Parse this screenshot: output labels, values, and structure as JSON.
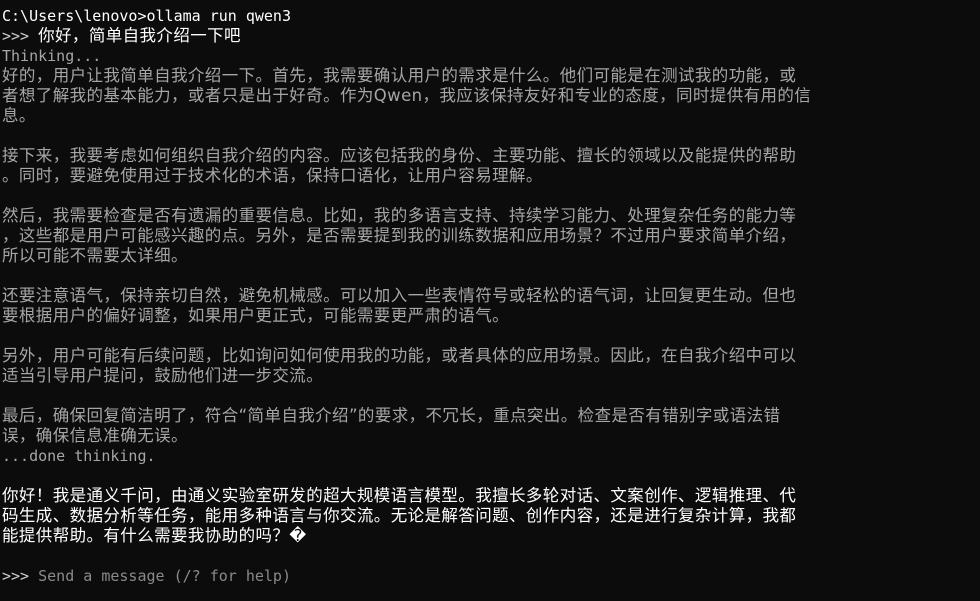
{
  "terminal": {
    "command_line": "C:\\Users\\lenovo>ollama run qwen3",
    "user_prompt": {
      "marker": ">>>",
      "text": "你好，简单自我介绍一下吧"
    },
    "thinking_header": "Thinking...",
    "thinking_paragraphs": [
      [
        "好的，用户让我简单自我介绍一下。首先，我需要确认用户的需求是什么。他们可能是在测试我的功能，或",
        "者想了解我的基本能力，或者只是出于好奇。作为Qwen，我应该保持友好和专业的态度，同时提供有用的信",
        "息。"
      ],
      [
        "接下来，我要考虑如何组织自我介绍的内容。应该包括我的身份、主要功能、擅长的领域以及能提供的帮助",
        "。同时，要避免使用过于技术化的术语，保持口语化，让用户容易理解。"
      ],
      [
        "然后，我需要检查是否有遗漏的重要信息。比如，我的多语言支持、持续学习能力、处理复杂任务的能力等",
        "，这些都是用户可能感兴趣的点。另外，是否需要提到我的训练数据和应用场景？不过用户要求简单介绍，",
        "所以可能不需要太详细。"
      ],
      [
        "还要注意语气，保持亲切自然，避免机械感。可以加入一些表情符号或轻松的语气词，让回复更生动。但也",
        "要根据用户的偏好调整，如果用户更正式，可能需要更严肃的语气。"
      ],
      [
        "另外，用户可能有后续问题，比如询问如何使用我的功能，或者具体的应用场景。因此，在自我介绍中可以",
        "适当引导用户提问，鼓励他们进一步交流。"
      ],
      [
        "最后，确保回复简洁明了，符合“简单自我介绍”的要求，不冗长，重点突出。检查是否有错别字或语法错",
        "误，确保信息准确无误。"
      ]
    ],
    "thinking_footer": "...done thinking.",
    "answer_lines": [
      "你好！我是通义千问，由通义实验室研发的超大规模语言模型。我擅长多轮对话、文案创作、逻辑推理、代",
      "码生成、数据分析等任务，能用多种语言与你交流。无论是解答问题、创作内容，还是进行复杂计算，我都",
      "能提供帮助。有什么需要我协助的吗？�"
    ],
    "input": {
      "marker": ">>>",
      "placeholder": "Send a message (/? for help)"
    }
  }
}
